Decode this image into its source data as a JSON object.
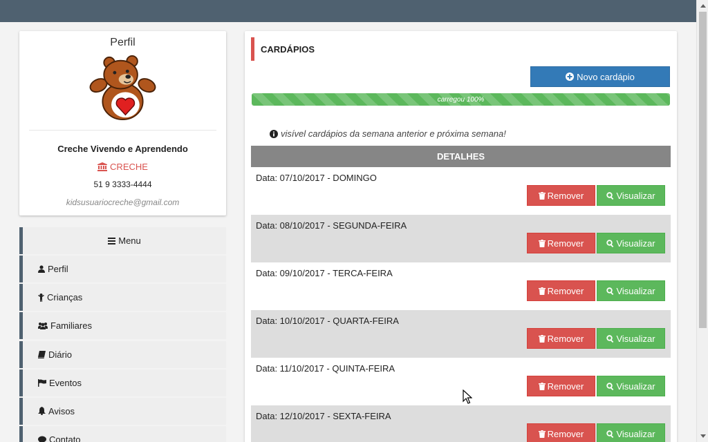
{
  "profile": {
    "title": "Perfil",
    "name": "Creche Vivendo e Aprendendo",
    "type": "CRECHE",
    "phone": "51 9 3333-4444",
    "email": "kidsusuariocreche@gmail.com"
  },
  "menu": {
    "header": "Menu",
    "items": [
      {
        "label": "Perfil",
        "icon": "user-icon"
      },
      {
        "label": "Crianças",
        "icon": "child-icon"
      },
      {
        "label": "Familiares",
        "icon": "users-icon"
      },
      {
        "label": "Diário",
        "icon": "book-icon"
      },
      {
        "label": "Eventos",
        "icon": "flag-icon"
      },
      {
        "label": "Avisos",
        "icon": "bell-icon"
      },
      {
        "label": "Contato",
        "icon": "comment-icon"
      }
    ]
  },
  "main": {
    "title": "CARDÁPIOS",
    "new_button": "Novo cardápio",
    "progress_label": "carregou 100%",
    "progress_percent": 100,
    "info": "visível cardápios da semana anterior e próxima semana!",
    "details_header": "DETALHES",
    "remove_label": "Remover",
    "view_label": "Visualizar",
    "rows": [
      {
        "date": "Data: 07/10/2017 - DOMINGO"
      },
      {
        "date": "Data: 08/10/2017 - SEGUNDA-FEIRA"
      },
      {
        "date": "Data: 09/10/2017 - TERCA-FEIRA"
      },
      {
        "date": "Data: 10/10/2017 - QUARTA-FEIRA"
      },
      {
        "date": "Data: 11/10/2017 - QUINTA-FEIRA"
      },
      {
        "date": "Data: 12/10/2017 - SEXTA-FEIRA"
      }
    ]
  },
  "colors": {
    "topbar": "#4f6170",
    "primary": "#337ab7",
    "danger": "#d9534f",
    "success": "#5cb85c"
  }
}
